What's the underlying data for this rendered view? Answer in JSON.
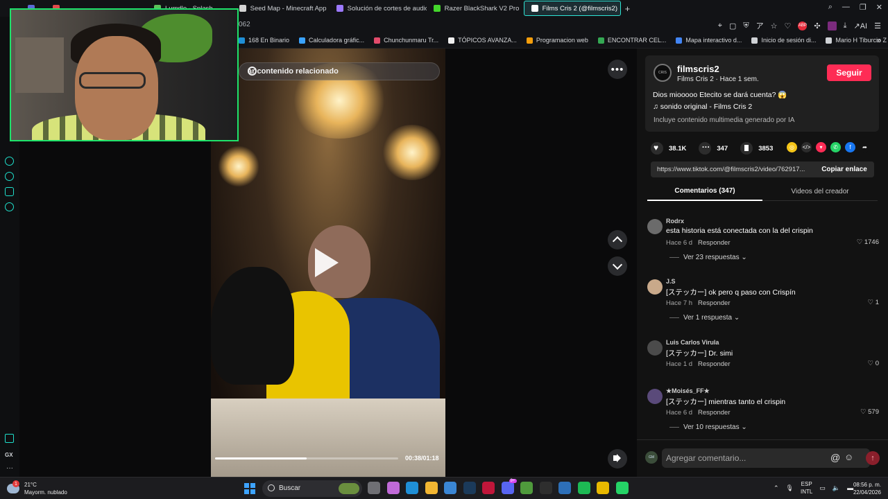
{
  "browser": {
    "tabs": [
      {
        "label": "",
        "color": "#5b6ad6"
      },
      {
        "label": "",
        "color": "#e24b4b"
      },
      {
        "label": "Lumdle - Splash",
        "color": "#5cc05a"
      },
      {
        "label": "Seed Map - Minecraft App",
        "color": "#d4d4d4"
      },
      {
        "label": "Solución de cortes de audio",
        "color": "#9c79ff"
      },
      {
        "label": "Razer BlackShark V2 Pro",
        "color": "#44d62c"
      },
      {
        "label": "Films Cris 2 (@filmscris2)",
        "color": "#ffffff"
      }
    ],
    "active_tab_index": 6,
    "url_fragment": "062",
    "bookmarks": [
      "168 En Binario",
      "Calculadora gráfic...",
      "Chunchunmaru Tr...",
      "TÓPICOS AVANZA...",
      "Programacion web",
      "ENCONTRAR CEL...",
      "Mapa interactivo d...",
      "Inicio de sesión di...",
      "Mario H Tiburcio Z"
    ],
    "toolbar_ai_label": "AI",
    "adblock_badge": "ABP",
    "gx_label": "GX",
    "accent_color": "#1fe0cc"
  },
  "video": {
    "search_placeholder": "ar contenido relacionado",
    "progress_fraction": 0.5,
    "timecode": "00:38/01:18",
    "more_label": "•••"
  },
  "post": {
    "avatar_text": "CRIS",
    "handle": "filmscris2",
    "subline": "Films Cris 2 · Hace 1 sem.",
    "follow_label": "Seguir",
    "follow_color": "#fe2c55",
    "caption": "Dios miooooo Etecito se dará cuenta? 😱",
    "music": "♫  sonido original - Films Cris 2",
    "ai_notice": "Incluye contenido multimedia generado por IA",
    "likes": "38.1K",
    "comments": "347",
    "saves": "3853",
    "share_icons": [
      {
        "name": "coin-icon",
        "color": "#f5c518",
        "glyph": "◎"
      },
      {
        "name": "embed-icon",
        "color": "#2c2c2c",
        "glyph": "</>"
      },
      {
        "name": "send-icon",
        "color": "#fe2c55",
        "glyph": "▾"
      },
      {
        "name": "whatsapp-icon",
        "color": "#25d366",
        "glyph": "✆"
      },
      {
        "name": "facebook-icon",
        "color": "#1877f2",
        "glyph": "f"
      },
      {
        "name": "share-arrow-icon",
        "color": "#121212",
        "glyph": "➦"
      }
    ],
    "link_url": "https://www.tiktok.com/@filmscris2/video/762917...",
    "copy_link_label": "Copiar enlace",
    "tab_comments": "Comentarios (347)",
    "tab_videos": "Videos del creador"
  },
  "comments": [
    {
      "user": "Rodrx",
      "text": "esta historia está conectada con la del crispin",
      "time": "Hace 6 d",
      "reply": "Responder",
      "likes": "1746",
      "more": "Ver 23 respuestas ⌄",
      "avatar_color": "#6b6b6b"
    },
    {
      "user": "J.S",
      "text": "[ステッカー] ok pero q paso con Crispín",
      "time": "Hace 7 h",
      "reply": "Responder",
      "likes": "1",
      "more": "Ver 1 respuesta ⌄",
      "avatar_color": "#c9a98a"
    },
    {
      "user": "Luis Carlos Virula",
      "text": "[ステッカー] Dr. simi",
      "time": "Hace 1 d",
      "reply": "Responder",
      "likes": "0",
      "more": "",
      "avatar_color": "#4b4b4b"
    },
    {
      "user": "★Moisés_FF★",
      "text": "[ステッカー] mientras tanto el crispin",
      "time": "Hace 6 d",
      "reply": "Responder",
      "likes": "579",
      "more": "Ver 10 respuestas ⌄",
      "avatar_color": "#5a4a7a"
    }
  ],
  "composer": {
    "placeholder": "Agregar comentario...",
    "avatar_text": "GM",
    "at_symbol": "@",
    "emoji_symbol": "☺",
    "send_symbol": "↑"
  },
  "taskbar": {
    "weather_temp": "21°C",
    "weather_desc": "Mayorm. nublado",
    "weather_badge": "1",
    "search_label": "Buscar",
    "discord_badge": "9+",
    "lang_top": "ESP",
    "lang_bottom": "INTL",
    "time": "08:56 p. m.",
    "date": "22/04/2026",
    "apps": [
      {
        "name": "task-view-icon",
        "color": "#6f6f74"
      },
      {
        "name": "copilot-icon",
        "color": "#c06ad8"
      },
      {
        "name": "edge-icon",
        "color": "#1f8fd6"
      },
      {
        "name": "file-explorer-icon",
        "color": "#f2b632"
      },
      {
        "name": "store-icon",
        "color": "#3a86d4"
      },
      {
        "name": "steam-icon",
        "color": "#1b3a5a"
      },
      {
        "name": "opera-gx-icon",
        "color": "#c0163a"
      },
      {
        "name": "discord-icon",
        "color": "#5865f2"
      },
      {
        "name": "minecraft-icon",
        "color": "#4f9a3c"
      },
      {
        "name": "epic-games-icon",
        "color": "#2e2e2e"
      },
      {
        "name": "launcher-icon",
        "color": "#2d6fb8"
      },
      {
        "name": "spotify-icon",
        "color": "#1db954"
      },
      {
        "name": "chrome-icon",
        "color": "#e8b800"
      },
      {
        "name": "whatsapp-desktop-icon",
        "color": "#25d366"
      }
    ]
  }
}
